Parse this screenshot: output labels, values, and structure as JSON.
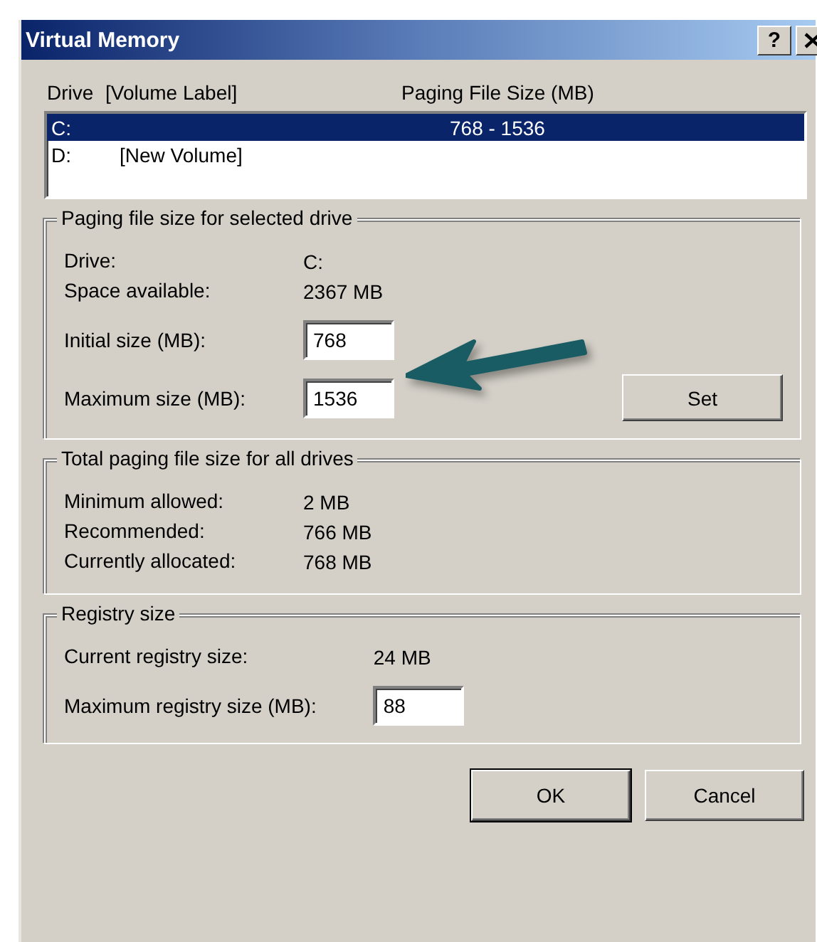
{
  "window": {
    "title": "Virtual Memory",
    "help_button": "?"
  },
  "drive_list": {
    "headings": [
      "Drive",
      "[Volume Label]",
      "Paging File Size (MB)"
    ],
    "rows": [
      {
        "drive": "C:",
        "size": "768 - 1536",
        "selected": true
      },
      {
        "drive": "D:",
        "label": "[New Volume]",
        "selected": false
      }
    ]
  },
  "groups": [
    {
      "title": "Paging file size for selected drive",
      "rows": [
        {
          "kind": "info",
          "label": "Drive:",
          "value": "C:"
        },
        {
          "kind": "info",
          "label": "Space available:",
          "value": "2367 MB"
        },
        {
          "kind": "field",
          "label": "Initial size (MB):",
          "value": "768"
        },
        {
          "kind": "field",
          "label": "Maximum size (MB):",
          "value": "1536",
          "button": "Set"
        }
      ]
    },
    {
      "title": "Total paging file size for all drives",
      "rows": [
        {
          "kind": "info",
          "label": "Minimum allowed:",
          "value": "2 MB"
        },
        {
          "kind": "info",
          "label": "Recommended:",
          "value": "766 MB"
        },
        {
          "kind": "info",
          "label": "Currently allocated:",
          "value": "768 MB"
        }
      ]
    },
    {
      "title": "Registry size",
      "rows": [
        {
          "kind": "info",
          "label": "Current registry size:",
          "value": "24 MB"
        },
        {
          "kind": "field",
          "label": "Maximum registry size (MB):",
          "value": "88"
        }
      ]
    }
  ],
  "buttons": [
    "OK",
    "Cancel"
  ]
}
